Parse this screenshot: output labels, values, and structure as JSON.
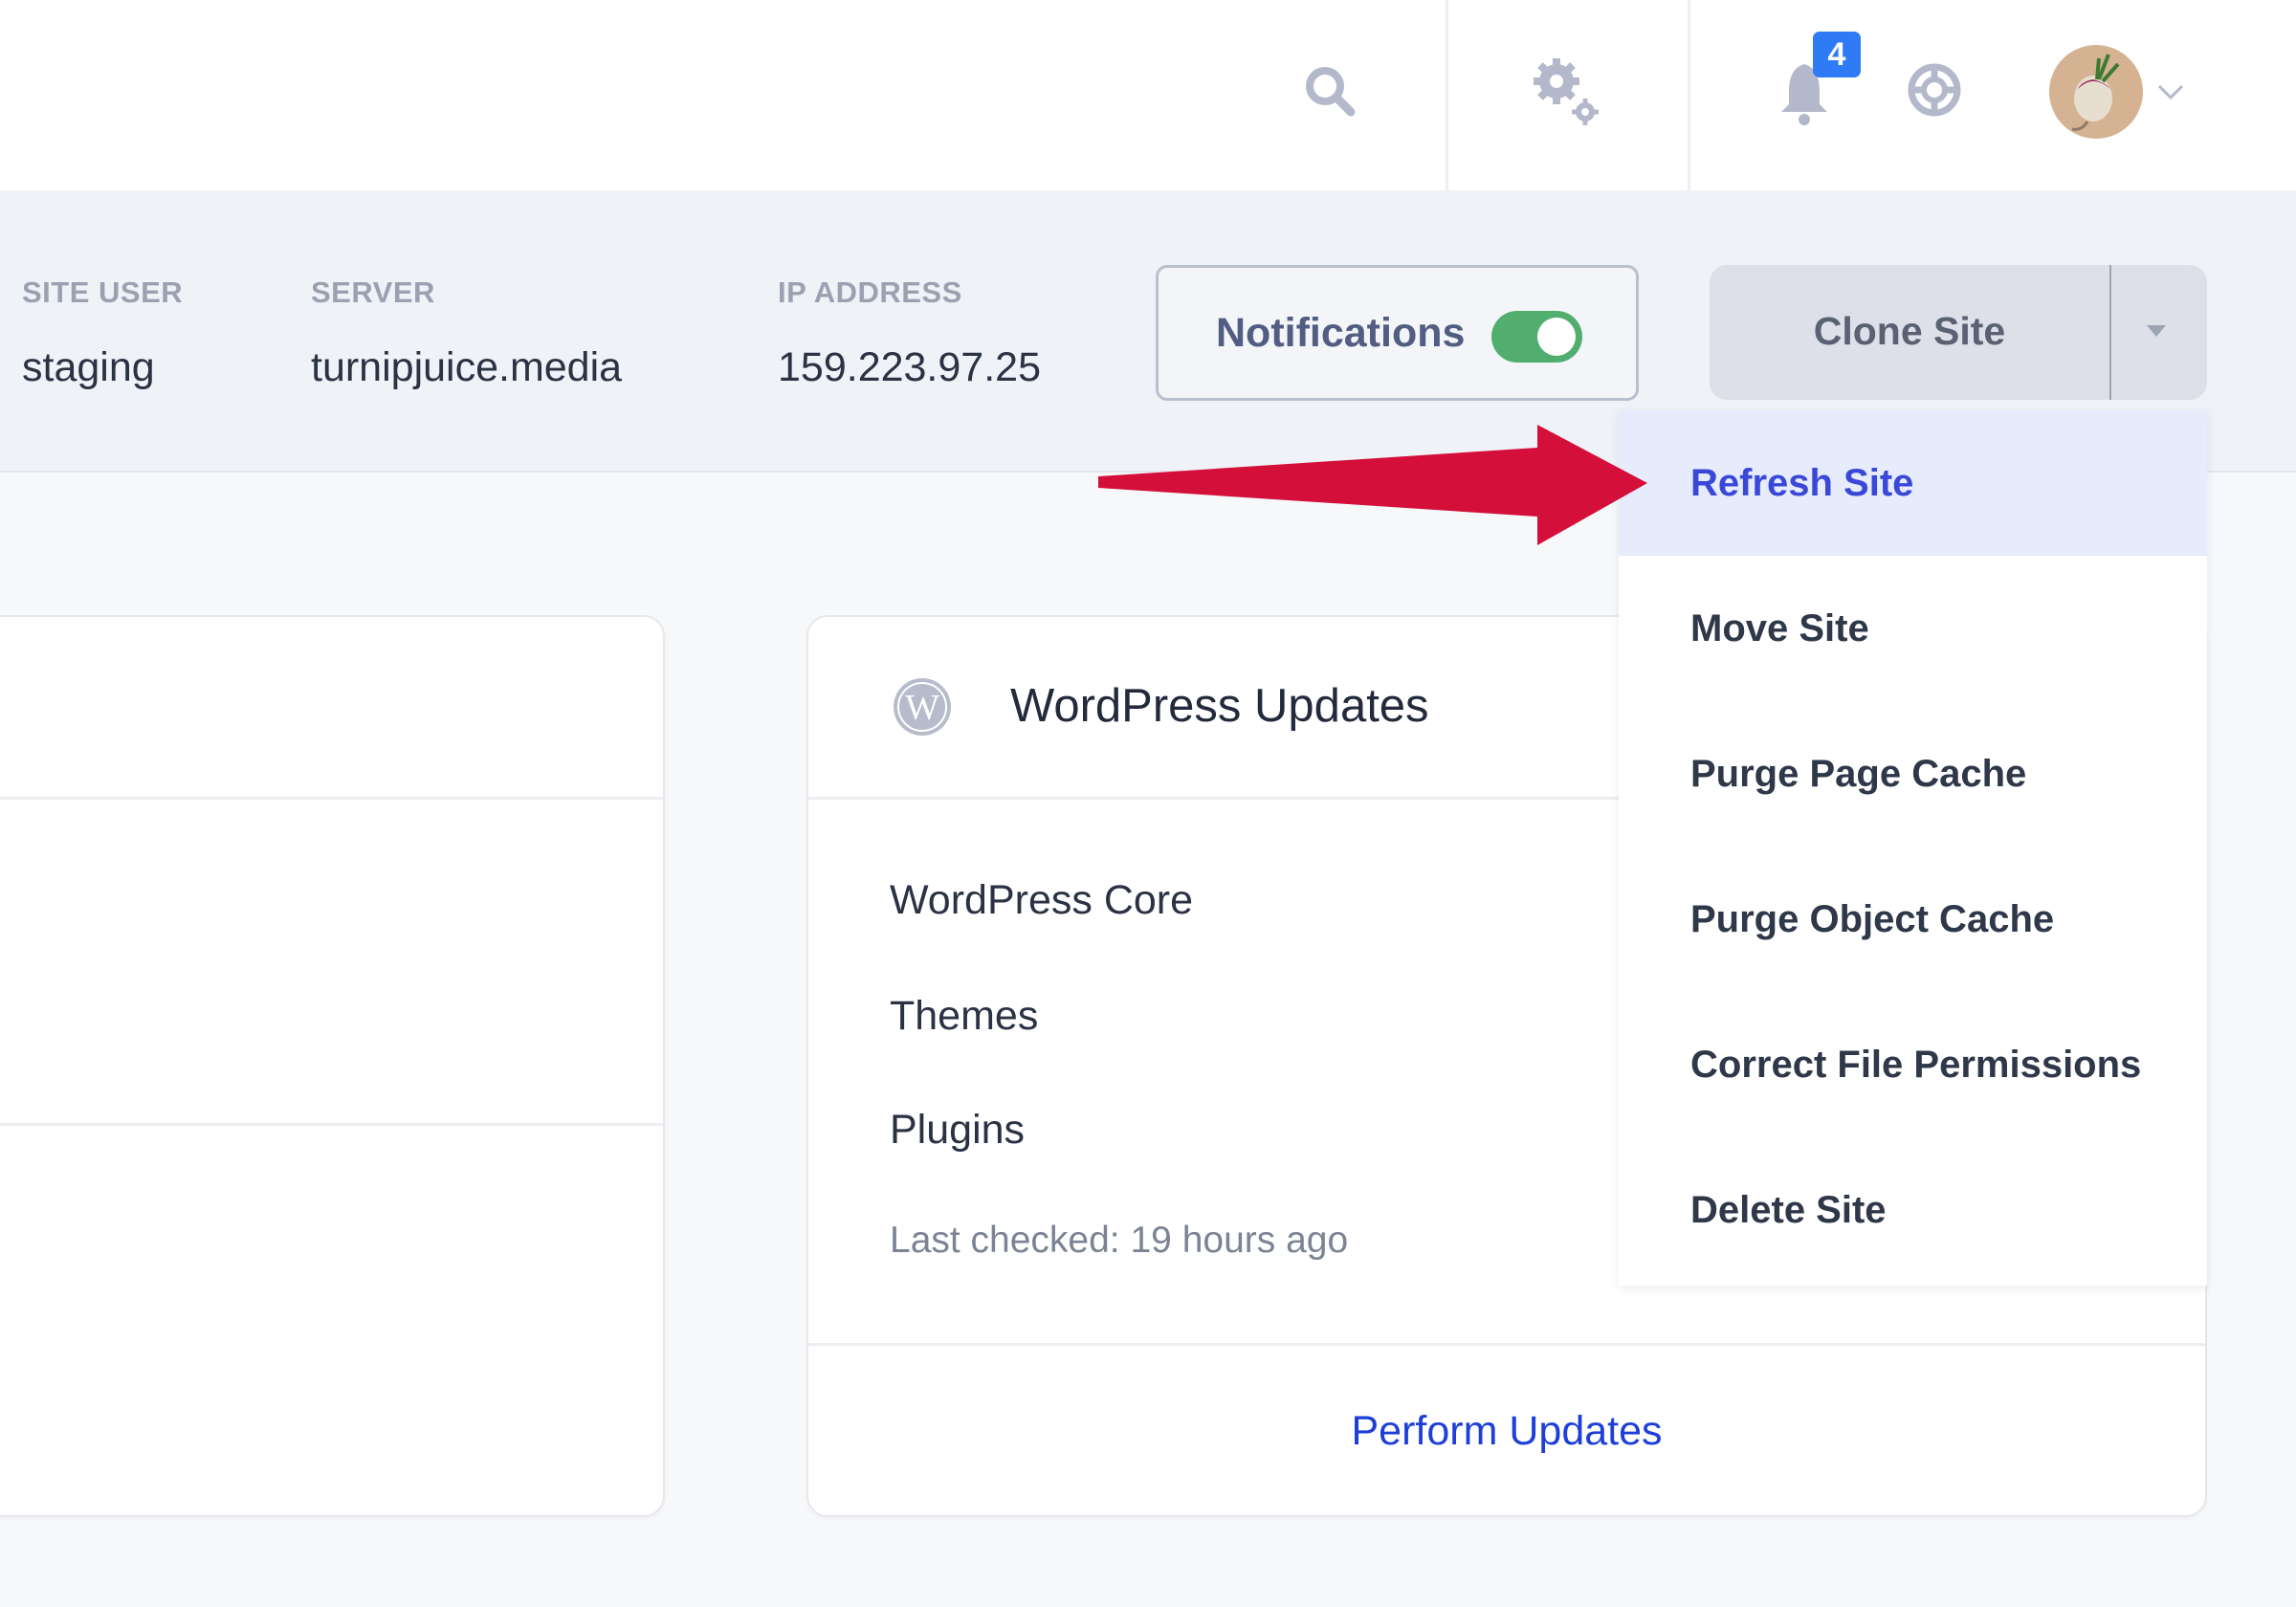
{
  "header": {
    "icons": [
      "search-icon",
      "gear-icon",
      "bell-icon",
      "lifebuoy-icon",
      "avatar",
      "chevron-down-icon"
    ],
    "notification_count": "4"
  },
  "site_info": {
    "site_user_label": "SITE USER",
    "site_user_value": "staging",
    "server_label": "SERVER",
    "server_value": "turnipjuice.media",
    "ip_label": "IP ADDRESS",
    "ip_value": "159.223.97.25"
  },
  "notifications": {
    "label": "Notifications",
    "enabled": true,
    "color": "#52ae6f"
  },
  "clone_button": {
    "label": "Clone Site"
  },
  "dropdown": {
    "items": [
      {
        "label": "Refresh Site",
        "active": true
      },
      {
        "label": "Move Site"
      },
      {
        "label": "Purge Page Cache"
      },
      {
        "label": "Purge Object Cache"
      },
      {
        "label": "Correct File Permissions"
      },
      {
        "label": "Delete Site"
      }
    ]
  },
  "wp_updates": {
    "title": "WordPress Updates",
    "rows": [
      "WordPress Core",
      "Themes",
      "Plugins"
    ],
    "last_checked": "Last checked: 19 hours ago",
    "action": "Perform Updates"
  },
  "colors": {
    "accent": "#3a48d8",
    "arrow": "#d30f3a",
    "link": "#1d3fd8",
    "badge": "#2f7bf5"
  }
}
